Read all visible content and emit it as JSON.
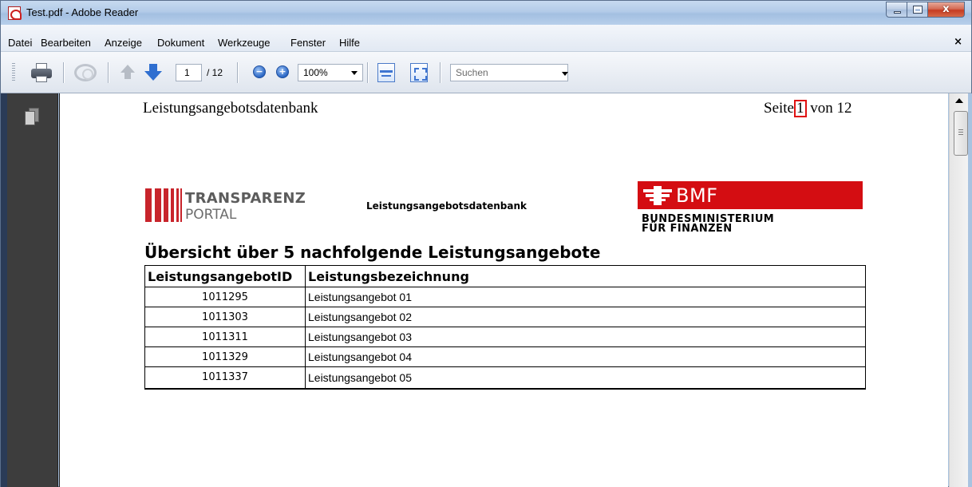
{
  "window": {
    "title": "Test.pdf - Adobe Reader",
    "close_glyph": "x"
  },
  "menubar": {
    "items": [
      "Datei",
      "Bearbeiten",
      "Anzeige",
      "Dokument",
      "Werkzeuge",
      "Fenster",
      "Hilfe"
    ],
    "close_doc": "×"
  },
  "toolbar": {
    "page_current": "1",
    "page_total": "/ 12",
    "zoom_value": "100%",
    "zoom_out": "−",
    "zoom_in": "+",
    "search_placeholder": "Suchen"
  },
  "document": {
    "header_left": "Leistungsangebotsdatenbank",
    "header_page_prefix": "Seite",
    "header_page_current": "1",
    "header_page_suffix": "von 12",
    "logo_line1": "TRANSPARENZ",
    "logo_line2": "PORTAL",
    "center_title": "Leistungsangebotsdatenbank",
    "bmf_logo": "BMF",
    "bmf_line1": "BUNDESMINISTERIUM",
    "bmf_line2": "FÜR FINANZEN",
    "overview_title": "Übersicht über 5 nachfolgende Leistungsangebote",
    "table": {
      "headers": [
        "LeistungsangebotID",
        "Leistungsbezeichnung"
      ],
      "rows": [
        [
          "1011295",
          "Leistungsangebot 01"
        ],
        [
          "1011303",
          "Leistungsangebot 02"
        ],
        [
          "1011311",
          "Leistungsangebot 03"
        ],
        [
          "1011329",
          "Leistungsangebot 04"
        ],
        [
          "1011337",
          "Leistungsangebot 05"
        ]
      ]
    }
  },
  "colors": {
    "brand_red": "#d40d12",
    "portal_red": "#c8242b",
    "highlight_red": "#e01010"
  }
}
